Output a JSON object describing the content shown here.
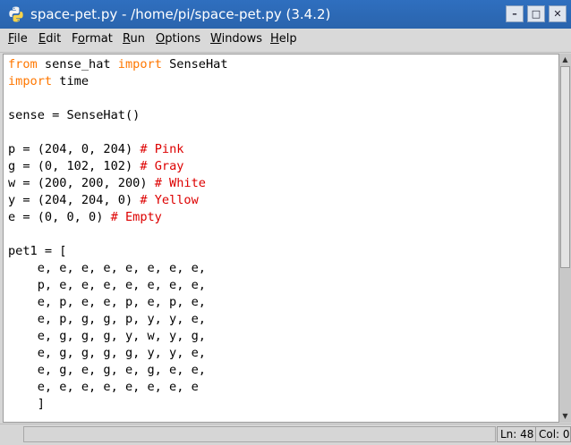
{
  "window": {
    "title": "space-pet.py - /home/pi/space-pet.py (3.4.2)",
    "buttons": {
      "minimize": "–",
      "maximize": "□",
      "close": "✕"
    }
  },
  "menu": [
    {
      "u": "F",
      "rest": "ile"
    },
    {
      "u": "E",
      "rest": "dit"
    },
    {
      "pre": "F",
      "u": "o",
      "rest": "rmat"
    },
    {
      "u": "R",
      "rest": "un"
    },
    {
      "u": "O",
      "rest": "ptions"
    },
    {
      "u": "W",
      "rest": "indows"
    },
    {
      "u": "H",
      "rest": "elp"
    }
  ],
  "code": {
    "l1_kw1": "from",
    "l1_mid": " sense_hat ",
    "l1_kw2": "import",
    "l1_end": " SenseHat",
    "l2_kw": "import",
    "l2_end": " time",
    "l4": "sense = SenseHat()",
    "l6_code": "p = (204, 0, 204) ",
    "l6_comment": "# Pink",
    "l7_code": "g = (0, 102, 102) ",
    "l7_comment": "# Gray",
    "l8_code": "w = (200, 200, 200) ",
    "l8_comment": "# White",
    "l9_code": "y = (204, 204, 0) ",
    "l9_comment": "# Yellow",
    "l10_code": "e = (0, 0, 0) ",
    "l10_comment": "# Empty",
    "l12": "pet1 = [",
    "l13": "    e, e, e, e, e, e, e, e,",
    "l14": "    p, e, e, e, e, e, e, e,",
    "l15": "    e, p, e, e, p, e, p, e,",
    "l16": "    e, p, g, g, p, y, y, e,",
    "l17": "    e, g, g, g, y, w, y, g,",
    "l18": "    e, g, g, g, g, y, y, e,",
    "l19": "    e, g, e, g, e, g, e, e,",
    "l20": "    e, e, e, e, e, e, e, e",
    "l21": "    ]"
  },
  "status": {
    "line": "Ln: 48",
    "col": "Col: 0"
  },
  "colors": {
    "keyword": "#ff7700",
    "comment": "#dd0000",
    "titlebar": "#2f6fbf"
  }
}
